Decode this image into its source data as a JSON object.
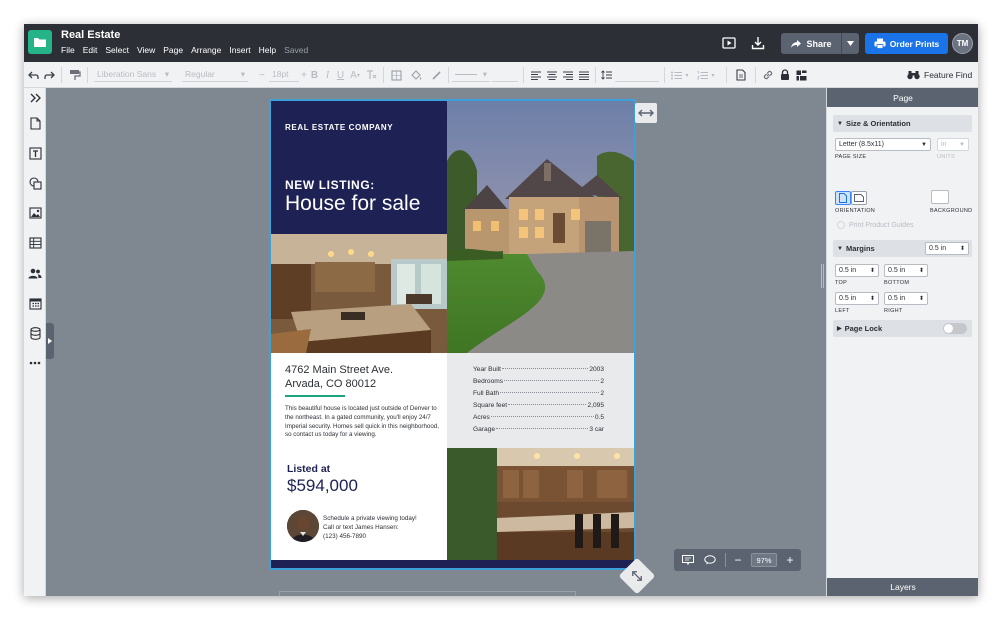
{
  "app": {
    "title": "Real Estate",
    "menu": [
      "File",
      "Edit",
      "Select",
      "View",
      "Page",
      "Arrange",
      "Insert",
      "Help"
    ],
    "status": "Saved",
    "share_label": "Share",
    "order_label": "Order Prints",
    "user_initials": "TM",
    "accent_color": "#25b487",
    "order_color": "#1a73e8"
  },
  "toolbar": {
    "font": "Liberation Sans",
    "weight": "Regular",
    "size": "18pt",
    "bold": "B",
    "italic": "I",
    "underline": "U",
    "text_color": "A",
    "feature_find": "Feature Find"
  },
  "flyer": {
    "company": "REAL ESTATE COMPANY",
    "headline_small": "NEW LISTING:",
    "headline_large": "House for sale",
    "address_line1": "4762 Main Street Ave.",
    "address_line2": "Arvada, CO 80012",
    "description": "This beautiful house is located just outside of Denver to the northeast.  In a gated community, you'll enjoy 24/7 Imperial security. Homes sell quick in this neighborhood, so contact us today for a viewing.",
    "listed_label": "Listed at",
    "price": "$594,000",
    "agent_line1": "Schedule a private viewing today!",
    "agent_line2": "Call or text James Hansen:",
    "agent_line3": "(123) 456-7890",
    "specs": [
      {
        "label": "Year Built",
        "value": "2003"
      },
      {
        "label": "Bedrooms",
        "value": "2"
      },
      {
        "label": "Full Bath",
        "value": "2"
      },
      {
        "label": "Square feet",
        "value": "2,095"
      },
      {
        "label": "Acres",
        "value": "0.5"
      },
      {
        "label": "Garage",
        "value": "3 car"
      }
    ],
    "navy": "#1e2153"
  },
  "canvas": {
    "zoom": "97%"
  },
  "panel": {
    "title": "Page",
    "size_section": "Size & Orientation",
    "page_size": "Letter (8.5x11)",
    "page_size_label": "PAGE SIZE",
    "units": "in",
    "units_label": "UNITS",
    "orientation_label": "ORIENTATION",
    "background_label": "BACKGROUND",
    "print_guides": "Print Product Guides",
    "margins_section": "Margins",
    "margins_all": "0.5 in",
    "margin_top": "0.5 in",
    "margin_bottom": "0.5 in",
    "margin_left": "0.5 in",
    "margin_right": "0.5 in",
    "top_label": "TOP",
    "bottom_label": "BOTTOM",
    "left_label": "LEFT",
    "right_label": "RIGHT",
    "page_lock": "Page Lock",
    "layers": "Layers"
  }
}
